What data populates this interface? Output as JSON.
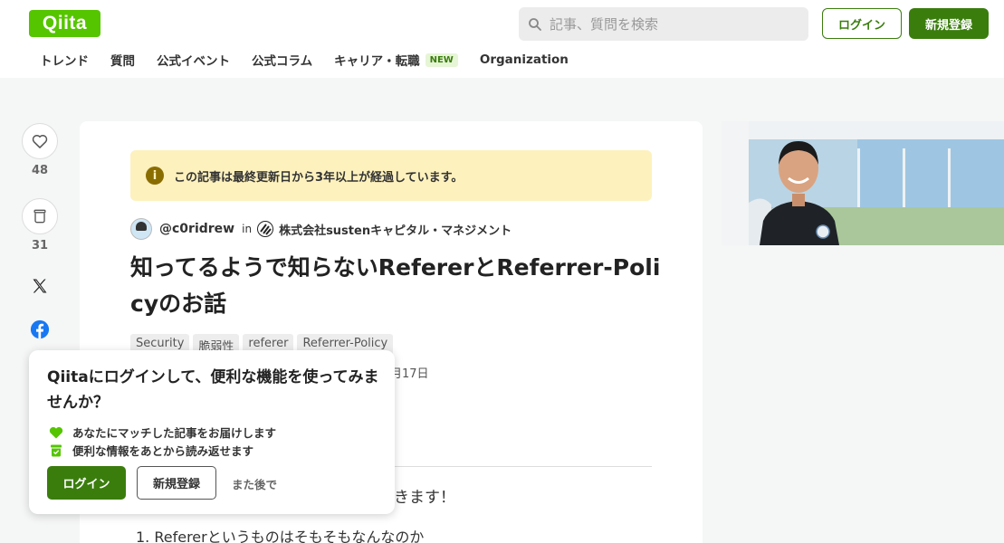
{
  "header": {
    "logo": "Qiita",
    "search_placeholder": "記事、質問を検索",
    "login_label": "ログイン",
    "signup_label": "新規登録"
  },
  "nav": {
    "items": [
      "トレンド",
      "質問",
      "公式イベント",
      "公式コラム",
      "キャリア・転職",
      "Organization"
    ],
    "new_badge": "NEW"
  },
  "rail": {
    "like_count": "48",
    "stock_count": "31"
  },
  "article": {
    "notice": "この記事は最終更新日から3年以上が経過しています。",
    "author": "@c0ridrew",
    "in_label": "in",
    "organization": "株式会社sustenキャピタル・マネジメント",
    "title": "知ってるようで知らないRefererとReferrer-Policyのお話",
    "tags": [
      "Security",
      "脆弱性",
      "referer",
      "Referrer-Policy"
    ],
    "date_fragment": "月17日",
    "body_fragment": "きます！",
    "list_item_1": "1. Refererというものはそもそもなんなのか"
  },
  "popup": {
    "title": "Qiitaにログインして、便利な機能を使ってみませんか？",
    "feature_1": "あなたにマッチした記事をお届けします",
    "feature_2": "便利な情報をあとから読み返せます",
    "login_label": "ログイン",
    "signup_label": "新規登録",
    "later_label": "また後で"
  },
  "colors": {
    "brand": "#55c500",
    "primary_button": "#3a7d0d",
    "notice_bg": "#fdf1bd"
  },
  "icons": {
    "like": "heart-icon",
    "stock": "stock-icon",
    "x": "x-icon",
    "facebook": "facebook-icon",
    "search": "search-icon",
    "notice": "info-icon"
  }
}
